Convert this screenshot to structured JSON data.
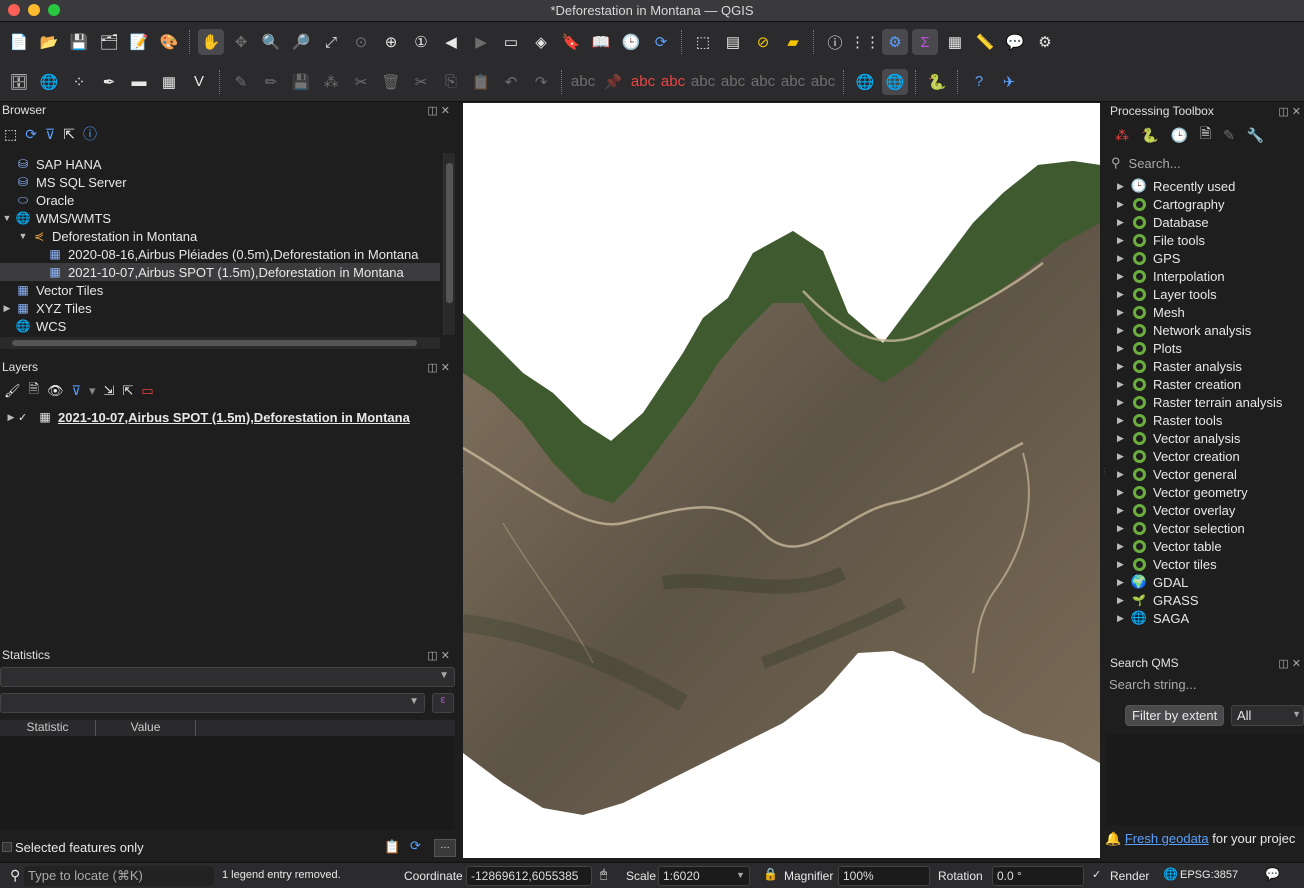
{
  "window": {
    "title": "*Deforestation in Montana — QGIS"
  },
  "toolbar1": {
    "icons": [
      "new-project",
      "open-project",
      "save-project",
      "save-as",
      "print-layout",
      "style-manager",
      "pan",
      "pan-to-selection",
      "zoom-in",
      "zoom-out",
      "zoom-full",
      "zoom-to-selection",
      "zoom-to-layer",
      "zoom-native",
      "zoom-last",
      "zoom-next",
      "new-map-view",
      "new-3d-view",
      "new-spatial-bookmark",
      "show-bookmarks",
      "temporal-controller",
      "refresh",
      "select-features",
      "select-by-value",
      "deselect-all",
      "select-location",
      "identify",
      "open-attribute-table",
      "field-calculator",
      "statistical-summary",
      "attribute-table",
      "measure",
      "map-tips",
      "processing-settings"
    ]
  },
  "browser": {
    "title": "Browser",
    "items": [
      {
        "label": "SAP HANA",
        "icon": "sap-hana-icon",
        "indent": 0,
        "arrow": ""
      },
      {
        "label": "MS SQL Server",
        "icon": "mssql-icon",
        "indent": 0,
        "arrow": ""
      },
      {
        "label": "Oracle",
        "icon": "oracle-icon",
        "indent": 0,
        "arrow": ""
      },
      {
        "label": "WMS/WMTS",
        "icon": "wms-icon",
        "indent": 0,
        "arrow": "▼"
      },
      {
        "label": "Deforestation in Montana",
        "icon": "wms-connection-icon",
        "indent": 1,
        "arrow": "▼"
      },
      {
        "label": "2020-08-16,Airbus Pléiades (0.5m),Deforestation in Montana",
        "icon": "raster-layer-icon",
        "indent": 2,
        "arrow": ""
      },
      {
        "label": "2021-10-07,Airbus SPOT (1.5m),Deforestation in Montana",
        "icon": "raster-layer-icon",
        "indent": 2,
        "arrow": "",
        "selected": true
      },
      {
        "label": "Vector Tiles",
        "icon": "vector-tiles-icon",
        "indent": 0,
        "arrow": ""
      },
      {
        "label": "XYZ Tiles",
        "icon": "xyz-tiles-icon",
        "indent": 0,
        "arrow": "▶"
      },
      {
        "label": "WCS",
        "icon": "wcs-icon",
        "indent": 0,
        "arrow": ""
      }
    ]
  },
  "layers": {
    "title": "Layers",
    "items": [
      {
        "label": "2021-10-07,Airbus SPOT (1.5m),Deforestation in Montana",
        "checked": true
      }
    ]
  },
  "statistics": {
    "title": "Statistics",
    "col_statistic": "Statistic",
    "col_value": "Value",
    "selected_only": "Selected features only"
  },
  "processing": {
    "title": "Processing Toolbox",
    "search_placeholder": "Search...",
    "items": [
      {
        "label": "Recently used",
        "icon": "clock"
      },
      {
        "label": "Cartography",
        "icon": "qgis"
      },
      {
        "label": "Database",
        "icon": "qgis"
      },
      {
        "label": "File tools",
        "icon": "qgis"
      },
      {
        "label": "GPS",
        "icon": "qgis"
      },
      {
        "label": "Interpolation",
        "icon": "qgis"
      },
      {
        "label": "Layer tools",
        "icon": "qgis"
      },
      {
        "label": "Mesh",
        "icon": "qgis"
      },
      {
        "label": "Network analysis",
        "icon": "qgis"
      },
      {
        "label": "Plots",
        "icon": "qgis"
      },
      {
        "label": "Raster analysis",
        "icon": "qgis"
      },
      {
        "label": "Raster creation",
        "icon": "qgis"
      },
      {
        "label": "Raster terrain analysis",
        "icon": "qgis"
      },
      {
        "label": "Raster tools",
        "icon": "qgis"
      },
      {
        "label": "Vector analysis",
        "icon": "qgis"
      },
      {
        "label": "Vector creation",
        "icon": "qgis"
      },
      {
        "label": "Vector general",
        "icon": "qgis"
      },
      {
        "label": "Vector geometry",
        "icon": "qgis"
      },
      {
        "label": "Vector overlay",
        "icon": "qgis"
      },
      {
        "label": "Vector selection",
        "icon": "qgis"
      },
      {
        "label": "Vector table",
        "icon": "qgis"
      },
      {
        "label": "Vector tiles",
        "icon": "qgis"
      },
      {
        "label": "GDAL",
        "icon": "gdal"
      },
      {
        "label": "GRASS",
        "icon": "grass"
      },
      {
        "label": "SAGA",
        "icon": "saga"
      }
    ]
  },
  "qms": {
    "title": "Search QMS",
    "search_placeholder": "Search string...",
    "filter_button": "Filter by extent",
    "filter_combo": "All",
    "footer_link": "Fresh geodata",
    "footer_text": " for your projec"
  },
  "status": {
    "locate_placeholder": "Type to locate (⌘K)",
    "message": "1 legend entry removed.",
    "coordinate_label": "Coordinate",
    "coordinate_value": "-12869612,6055385",
    "scale_label": "Scale",
    "scale_value": "1:6020",
    "magnifier_label": "Magnifier",
    "magnifier_value": "100%",
    "rotation_label": "Rotation",
    "rotation_value": "0.0 °",
    "render_label": "Render",
    "crs": "EPSG:3857"
  },
  "colors": {
    "accent_blue": "#5aa0ff",
    "qgis_green": "#6cae3e",
    "forest": "#3f5a2e",
    "terrain": "#7a6a55"
  }
}
